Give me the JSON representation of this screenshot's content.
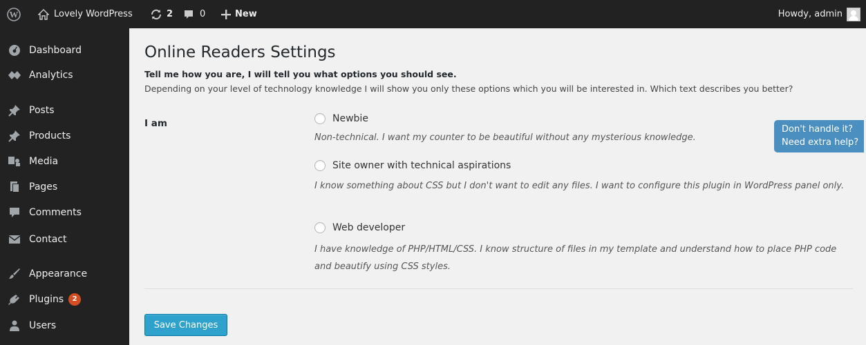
{
  "adminbar": {
    "site_name": "Lovely WordPress",
    "updates_count": "2",
    "comments_count": "0",
    "new_label": "New",
    "howdy": "Howdy, admin"
  },
  "sidebar": {
    "items": [
      {
        "label": "Dashboard",
        "icon": "dashboard-icon"
      },
      {
        "label": "Analytics",
        "icon": "analytics-icon"
      },
      {
        "label": "Posts",
        "icon": "pin-icon"
      },
      {
        "label": "Products",
        "icon": "pin-icon"
      },
      {
        "label": "Media",
        "icon": "media-icon"
      },
      {
        "label": "Pages",
        "icon": "pages-icon"
      },
      {
        "label": "Comments",
        "icon": "comment-icon"
      },
      {
        "label": "Contact",
        "icon": "mail-icon"
      },
      {
        "label": "Appearance",
        "icon": "brush-icon"
      },
      {
        "label": "Plugins",
        "icon": "plug-icon",
        "badge": "2"
      },
      {
        "label": "Users",
        "icon": "users-icon"
      }
    ]
  },
  "main": {
    "title": "Online Readers Settings",
    "intro_strong": "Tell me how you are, I will tell you what options you should see.",
    "intro_desc": "Depending on your level of technology knowledge I will show you only these options which you will be interested in. Which text describes you better?",
    "field_label": "I am",
    "options": [
      {
        "label": "Newbie",
        "desc": "Non-technical. I want my counter to be beautiful without any mysterious knowledge."
      },
      {
        "label": "Site owner with technical aspirations",
        "desc": "I know something about CSS but I don't want to edit any files. I want to configure this plugin in WordPress panel only."
      },
      {
        "label": "Web developer",
        "desc": "I have knowledge of PHP/HTML/CSS. I know structure of files in my template and understand how to place PHP code and beautify using CSS styles."
      }
    ],
    "save_label": "Save Changes",
    "help_line1": "Don't handle it?",
    "help_line2": "Need extra help?"
  },
  "colors": {
    "adminbar_bg": "#222222",
    "sidebar_bg": "#222222",
    "content_bg": "#f1f1f1",
    "primary_button": "#2ea2cc",
    "help_button": "#4a8fbf",
    "badge": "#d54e21"
  }
}
